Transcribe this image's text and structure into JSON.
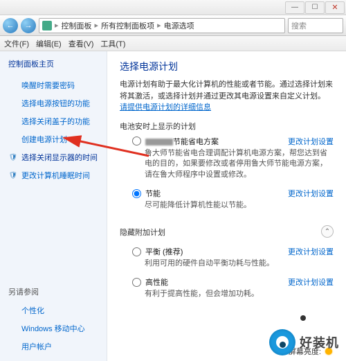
{
  "titlebar": {
    "minimize": "—",
    "maximize": "☐",
    "close": "✕"
  },
  "navbar": {
    "back_glyph": "←",
    "fwd_glyph": "→",
    "crumbs": [
      "控制面板",
      "所有控制面板项",
      "电源选项"
    ],
    "search_placeholder": "搜索"
  },
  "menubar": {
    "file": "文件(F)",
    "edit": "编辑(E)",
    "view": "查看(V)",
    "tools": "工具(T)"
  },
  "sidebar": {
    "home": "控制面板主页",
    "items": [
      "唤醒时需要密码",
      "选择电源按钮的功能",
      "选择关闭盖子的功能",
      "创建电源计划",
      "选择关闭显示器的时间",
      "更改计算机睡眠时间"
    ],
    "also_label": "另请参阅",
    "also_items": [
      "个性化",
      "Windows 移动中心",
      "用户帐户"
    ]
  },
  "content": {
    "heading": "选择电源计划",
    "desc_pre": "电源计划有助于最大化计算机的性能或者节能。通过选择计划来将其激活，或选择计划并通过更改其电源设置来自定义计划。",
    "desc_link": "请提供电源计划的详细信息",
    "battery_section": "电池安时上显示的计划",
    "plan1": {
      "name_suffix": "节能省电方案",
      "change": "更改计划设置",
      "desc": "鲁大师节能省电合理调配计算机电源方案，帮您达到省电的目的，如果要修改或者停用鲁大师节能电源方案，请在鲁大师程序中设置或修改。"
    },
    "plan2": {
      "name": "节能",
      "change": "更改计划设置",
      "desc": "尽可能降低计算机性能以节能。"
    },
    "hide_section": "隐藏附加计划",
    "plan3": {
      "name": "平衡 (推荐)",
      "change": "更改计划设置",
      "desc": "利用可用的硬件自动平衡功耗与性能。"
    },
    "plan4": {
      "name": "高性能",
      "change": "更改计划设置",
      "desc": "有利于提高性能，但会增加功耗。"
    },
    "brightness_label": "屏幕亮度:"
  },
  "watermark": {
    "text": "好装机"
  }
}
